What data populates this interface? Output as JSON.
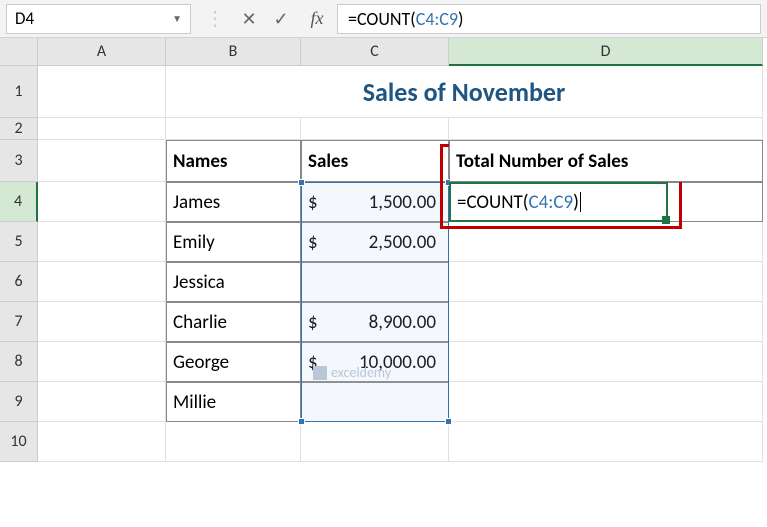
{
  "formula_bar": {
    "name_box": "D4",
    "cancel": "✕",
    "confirm": "✓",
    "fx": "fx",
    "formula_eq": "=",
    "formula_fn": "COUNT(",
    "formula_ref": "C4:C9",
    "formula_close": ")"
  },
  "columns": [
    "A",
    "B",
    "C",
    "D"
  ],
  "rows": [
    "1",
    "2",
    "3",
    "4",
    "5",
    "6",
    "7",
    "8",
    "9",
    "10"
  ],
  "title": "Sales of November",
  "headers": {
    "names": "Names",
    "sales": "Sales",
    "total": "Total Number of Sales"
  },
  "data": [
    {
      "name": "James",
      "sales_sym": "$",
      "sales_val": "1,500.00"
    },
    {
      "name": "Emily",
      "sales_sym": "$",
      "sales_val": "2,500.00"
    },
    {
      "name": "Jessica",
      "sales_sym": "",
      "sales_val": ""
    },
    {
      "name": "Charlie",
      "sales_sym": "$",
      "sales_val": "8,900.00"
    },
    {
      "name": "George",
      "sales_sym": "$",
      "sales_val": "10,000.00"
    },
    {
      "name": "Millie",
      "sales_sym": "",
      "sales_val": ""
    }
  ],
  "active_cell": {
    "eq": "=",
    "fn": "COUNT(",
    "ref": "C4:C9",
    "close": ")"
  },
  "watermark": "exceldemy"
}
